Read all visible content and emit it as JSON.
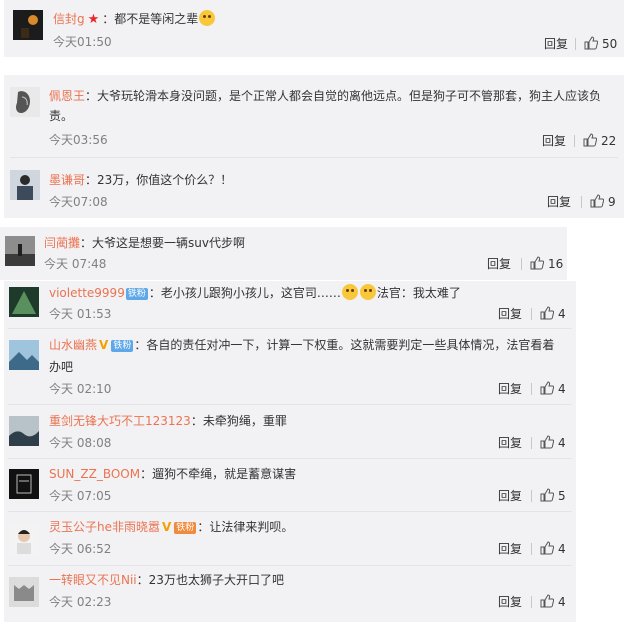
{
  "colors": {
    "username": "#eb7350",
    "badge": "#5ea7e8",
    "card": "#f2f2f5"
  },
  "icons": {
    "like": "thumbs-up-icon",
    "verified": "vip-v-icon",
    "star": "star-icon"
  },
  "comments": [
    {
      "user": "信封g",
      "sep": "：",
      "text": "都不是等闲之辈",
      "time": "今天01:50",
      "reply": "回复",
      "likes": "50"
    },
    {
      "user": "佩恩王",
      "sep": "：",
      "text": "大爷玩轮滑本身没问题，是个正常人都会自觉的离他远点。但是狗子可不管那套，狗主人应该负",
      "text2": "责。",
      "time": "今天03:56",
      "reply": "回复",
      "likes": "22"
    },
    {
      "user": "墨谦哥",
      "sep": "：",
      "text": "23万，你值这个价么？！",
      "time": "今天07:08",
      "reply": "回复",
      "likes": "9"
    },
    {
      "user": "闫蔺攤",
      "sep": "：",
      "text": "大爷这是想要一辆suv代步啊",
      "time": "今天 07:48",
      "reply": "回复",
      "likes": "16"
    },
    {
      "user": "violette9999",
      "badge": "铁粉",
      "sep": "：",
      "text": "老小孩儿跟狗小孩儿，这官司……",
      "text_b": "法官：我太难了",
      "time": "今天 01:53",
      "reply": "回复",
      "likes": "4"
    },
    {
      "user": "山水幽燕",
      "badge": "铁粉",
      "sep": "：",
      "text": "各自的责任对冲一下，计算一下权重。这就需要判定一些具体情况，法官看着",
      "text2": "办吧",
      "time": "今天 02:10",
      "reply": "回复",
      "likes": "4"
    },
    {
      "user": "重剑无锋大巧不工123123",
      "sep": "：",
      "text": "未牵狗绳，重罪",
      "time": "今天 08:08",
      "reply": "回复",
      "likes": "4"
    },
    {
      "user": "SUN_ZZ_BOOM",
      "sep": "：",
      "text": "遛狗不牵绳，就是蓄意谋害",
      "time": "今天 07:05",
      "reply": "回复",
      "likes": "5"
    },
    {
      "user": "灵玉公子he非雨晓嚣",
      "badge": "铁粉",
      "sep": "：",
      "text": "让法律来判呗。",
      "time": "今天 06:52",
      "reply": "回复",
      "likes": "4"
    },
    {
      "user": "一转眼又不见Nii",
      "sep": "：",
      "text": "23万也太狮子大开口了吧",
      "time": "今天 02:23",
      "reply": "回复",
      "likes": "4"
    }
  ]
}
